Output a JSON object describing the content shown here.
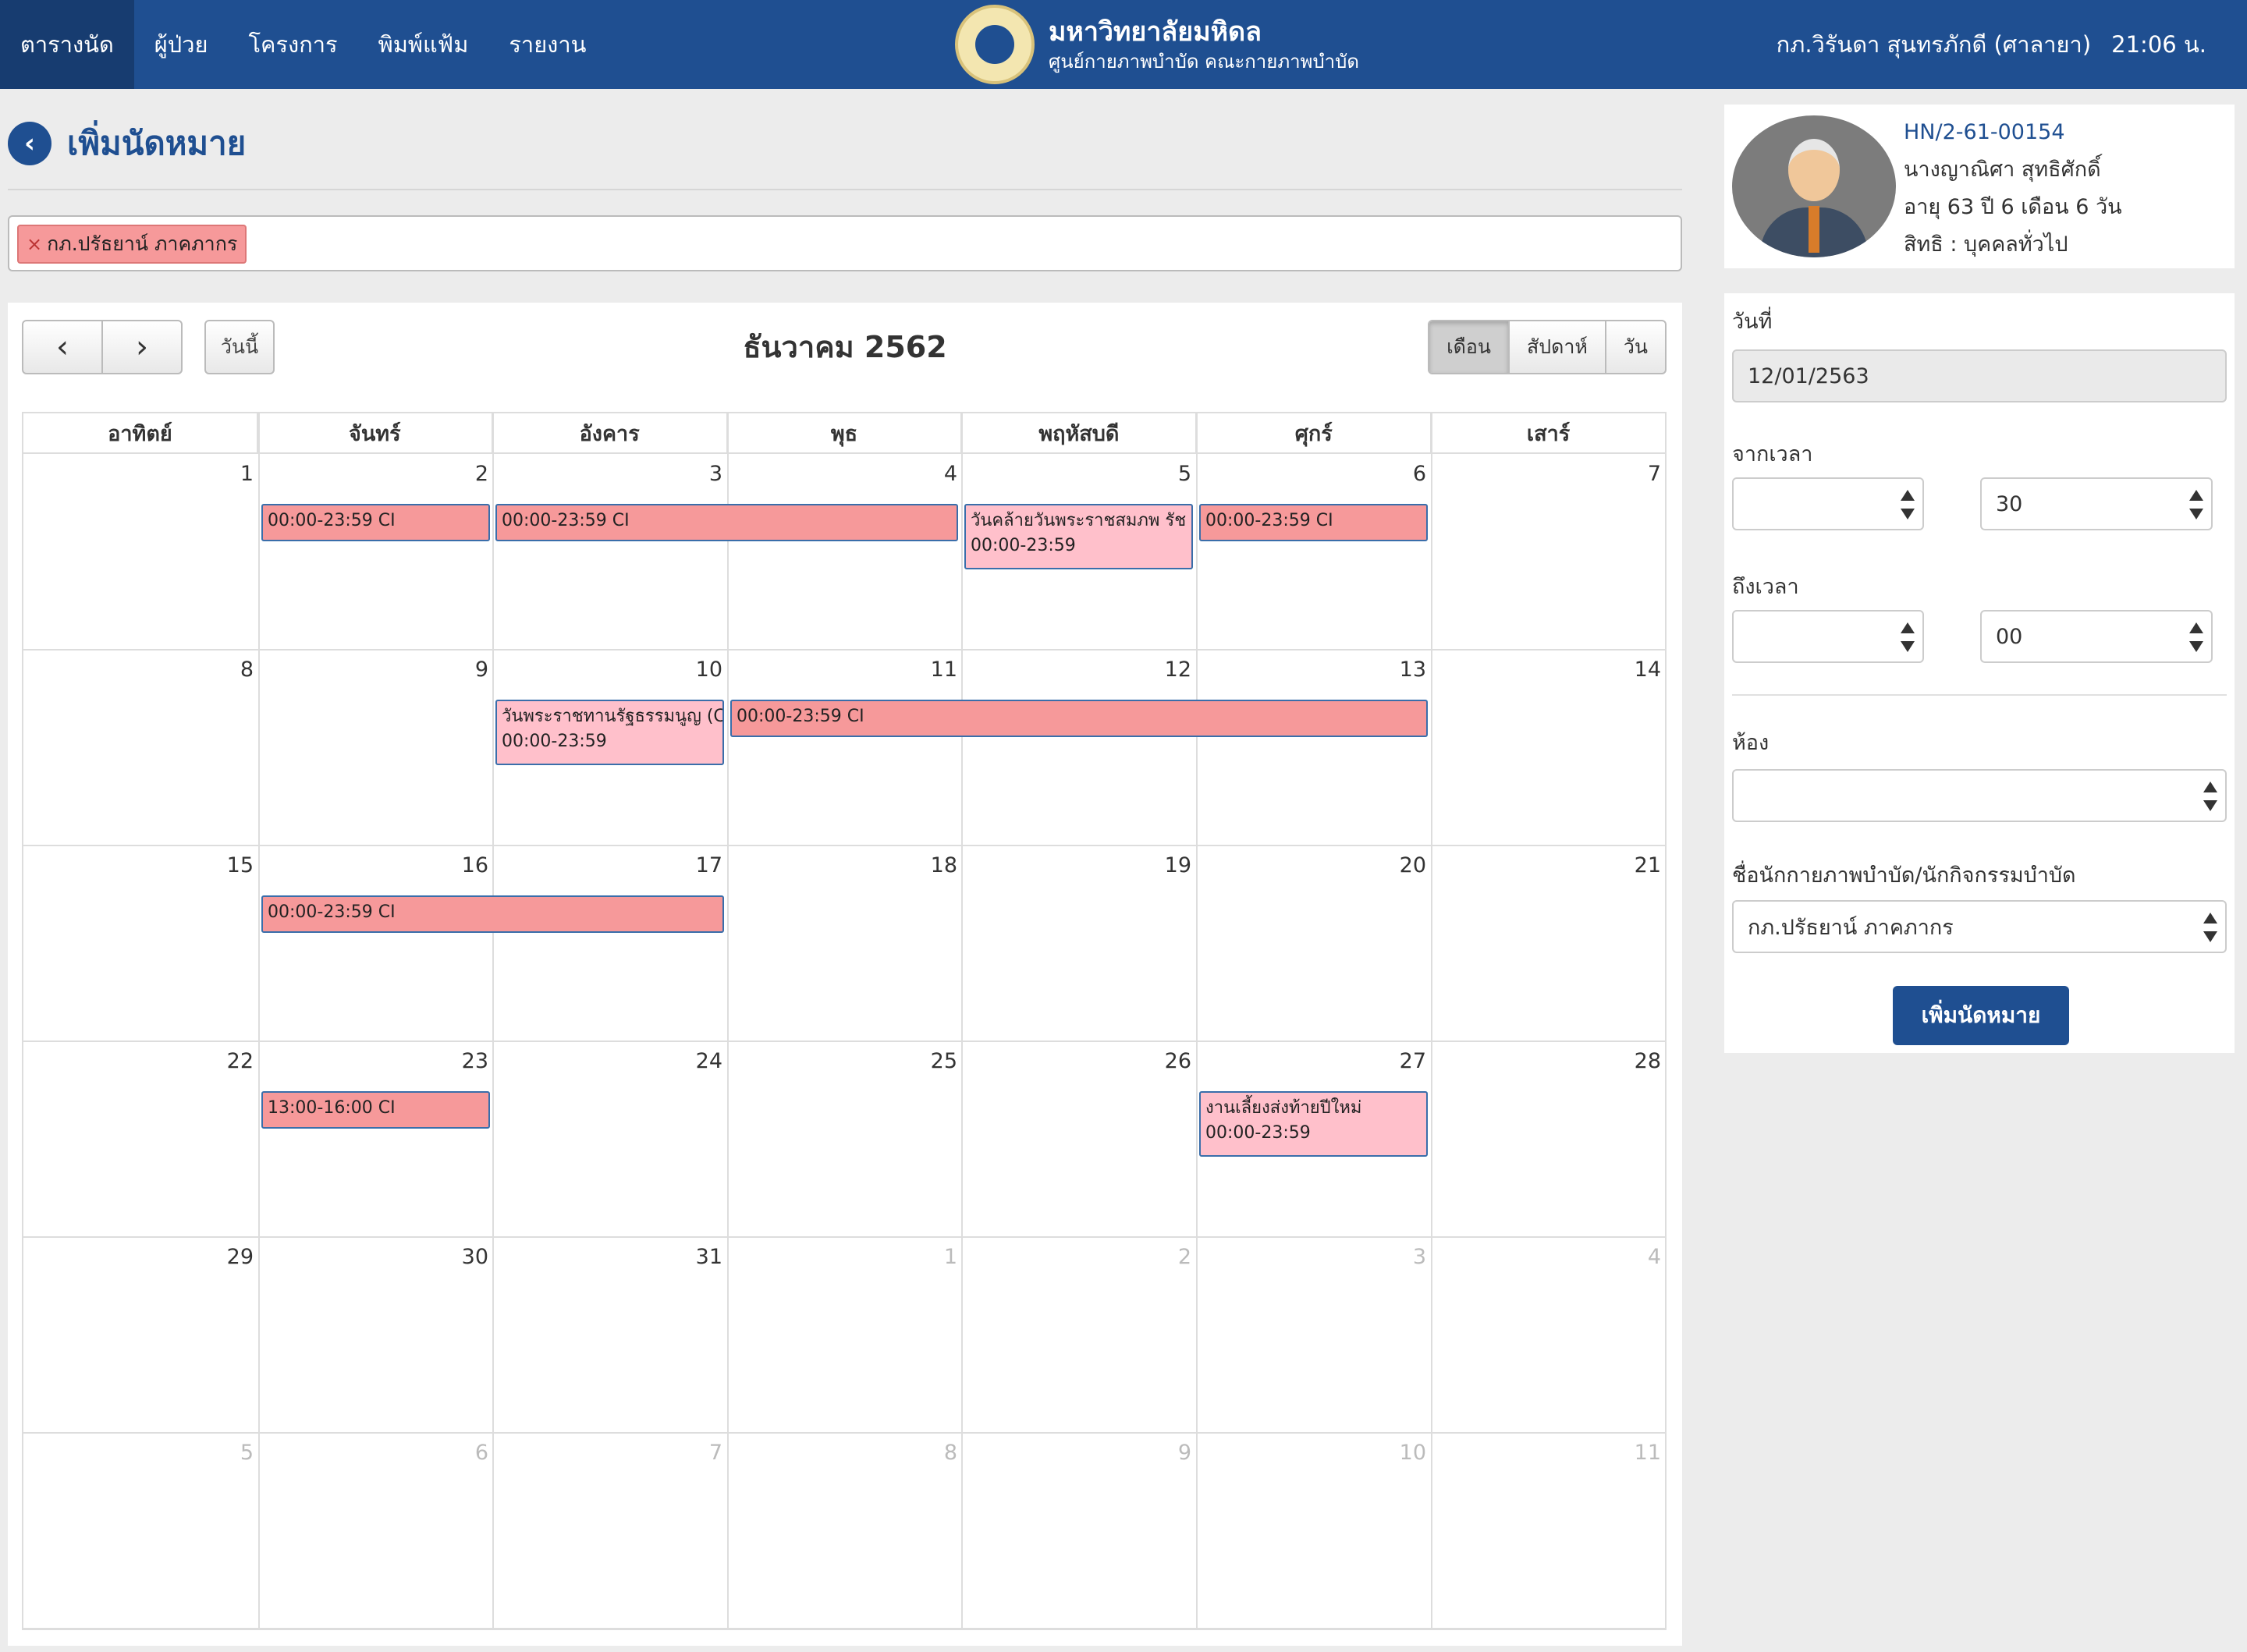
{
  "topbar": {
    "nav": [
      "ตารางนัด",
      "ผู้ป่วย",
      "โครงการ",
      "พิมพ์แฟ้ม",
      "รายงาน"
    ],
    "brand_title": "มหาวิทยาลัยมหิดล",
    "brand_sub": "ศูนย์กายภาพบำบัด คณะกายภาพบำบัด",
    "user": "กภ.วิรันดา สุนทรภักดี (ศาลายา)",
    "time": "21:06 น."
  },
  "page": {
    "title": "เพิ่มนัดหมาย",
    "filter_tag": "กภ.ปรัธยาน์ ภาคภากร",
    "filter_remove": "×"
  },
  "calendar": {
    "prev": "‹",
    "next": "›",
    "today": "วันนี้",
    "title": "ธันวาคม 2562",
    "views": [
      "เดือน",
      "สัปดาห์",
      "วัน"
    ],
    "active_view": "เดือน",
    "dow": [
      "อาทิตย์",
      "จันทร์",
      "อังคาร",
      "พุธ",
      "พฤหัสบดี",
      "ศุกร์",
      "เสาร์"
    ],
    "weeks": [
      [
        {
          "n": "1"
        },
        {
          "n": "2"
        },
        {
          "n": "3"
        },
        {
          "n": "4"
        },
        {
          "n": "5"
        },
        {
          "n": "6"
        },
        {
          "n": "7"
        }
      ],
      [
        {
          "n": "8"
        },
        {
          "n": "9"
        },
        {
          "n": "10"
        },
        {
          "n": "11"
        },
        {
          "n": "12"
        },
        {
          "n": "13"
        },
        {
          "n": "14"
        }
      ],
      [
        {
          "n": "15"
        },
        {
          "n": "16"
        },
        {
          "n": "17"
        },
        {
          "n": "18"
        },
        {
          "n": "19"
        },
        {
          "n": "20"
        },
        {
          "n": "21"
        }
      ],
      [
        {
          "n": "22"
        },
        {
          "n": "23"
        },
        {
          "n": "24"
        },
        {
          "n": "25"
        },
        {
          "n": "26"
        },
        {
          "n": "27"
        },
        {
          "n": "28"
        }
      ],
      [
        {
          "n": "29"
        },
        {
          "n": "30"
        },
        {
          "n": "31"
        },
        {
          "n": "1",
          "other": true
        },
        {
          "n": "2",
          "other": true
        },
        {
          "n": "3",
          "other": true
        },
        {
          "n": "4",
          "other": true
        }
      ],
      [
        {
          "n": "5",
          "other": true
        },
        {
          "n": "6",
          "other": true
        },
        {
          "n": "7",
          "other": true
        },
        {
          "n": "8",
          "other": true
        },
        {
          "n": "9",
          "other": true
        },
        {
          "n": "10",
          "other": true
        },
        {
          "n": "11",
          "other": true
        }
      ]
    ],
    "events": [
      {
        "week": 0,
        "start": 1,
        "span": 1,
        "kind": "ci",
        "lines": [
          "00:00-23:59 CI"
        ]
      },
      {
        "week": 0,
        "start": 2,
        "span": 2,
        "kind": "ci",
        "lines": [
          "00:00-23:59 CI"
        ]
      },
      {
        "week": 0,
        "start": 4,
        "span": 1,
        "kind": "hol",
        "lines": [
          "วันคล้ายวันพระราชสมภพ รัช",
          "00:00-23:59"
        ]
      },
      {
        "week": 0,
        "start": 5,
        "span": 1,
        "kind": "ci",
        "lines": [
          "00:00-23:59 CI"
        ]
      },
      {
        "week": 1,
        "start": 2,
        "span": 1,
        "kind": "hol",
        "lines": [
          "วันพระราชทานรัฐธรรมนูญ (C",
          "00:00-23:59"
        ]
      },
      {
        "week": 1,
        "start": 3,
        "span": 3,
        "kind": "ci",
        "lines": [
          "00:00-23:59 CI"
        ]
      },
      {
        "week": 2,
        "start": 1,
        "span": 2,
        "kind": "ci",
        "lines": [
          "00:00-23:59 CI"
        ]
      },
      {
        "week": 3,
        "start": 1,
        "span": 1,
        "kind": "ci",
        "lines": [
          "13:00-16:00 CI"
        ]
      },
      {
        "week": 3,
        "start": 5,
        "span": 1,
        "kind": "hol",
        "lines": [
          "งานเลี้ยงส่งท้ายปีใหม่",
          "00:00-23:59"
        ]
      }
    ]
  },
  "patient": {
    "hn": "HN/2-61-00154",
    "name": "นางญาณิศา สุทธิศักดิ์",
    "age": "อายุ 63 ปี 6 เดือน 6 วัน",
    "rights": "สิทธิ : บุคคลทั่วไป"
  },
  "form": {
    "date_label": "วันที่",
    "date_value": "12/01/2563",
    "from_label": "จากเวลา",
    "from_hour": "",
    "from_min": "30",
    "to_label": "ถึงเวลา",
    "to_hour": "",
    "to_min": "00",
    "room_label": "ห้อง",
    "room_value": "",
    "therapist_label": "ชื่อนักกายภาพบำบัด/นักกิจกรรมบำบัด",
    "therapist_value": "กภ.ปรัธยาน์ ภาคภากร",
    "submit": "เพิ่มนัดหมาย"
  },
  "colors": {
    "primary": "#1f4f91",
    "ci_event": "#f6999a",
    "holiday_event": "#ffc0cb"
  }
}
